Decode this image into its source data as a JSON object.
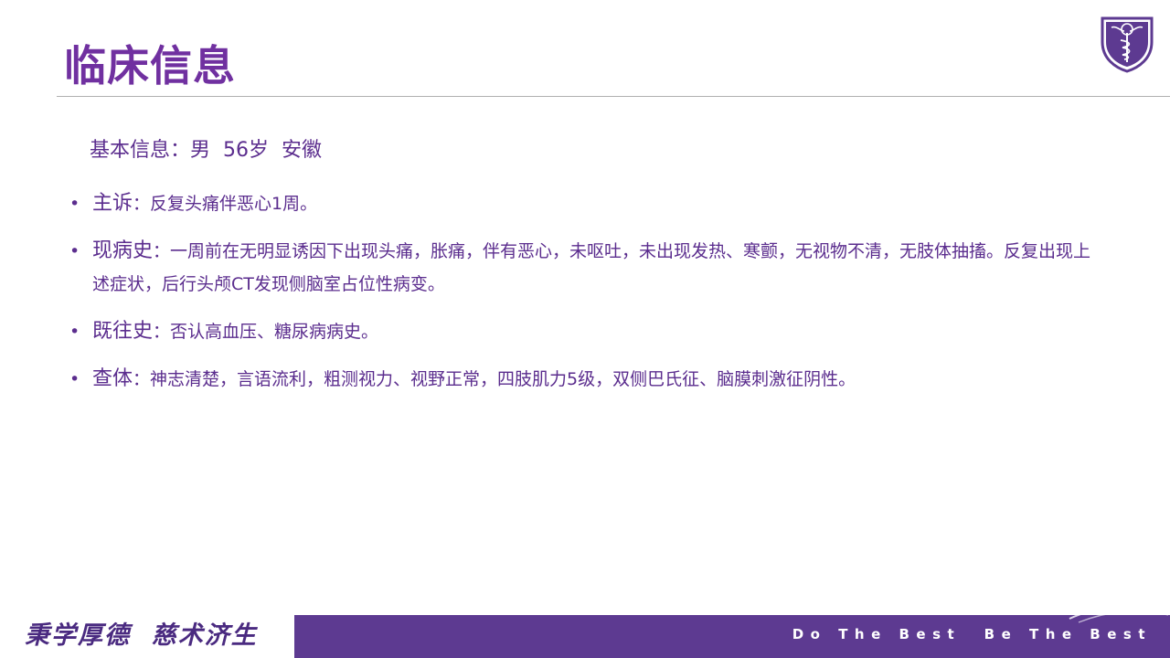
{
  "slide": {
    "title": "临床信息",
    "basic_info": "基本信息：男  56岁  安徽",
    "bullet_symbol": "•",
    "items": [
      {
        "label": "主诉",
        "text": "：反复头痛伴恶心1周。"
      },
      {
        "label": "现病史",
        "text": "：一周前在无明显诱因下出现头痛，胀痛，伴有恶心，未呕吐，未出现发热、寒颤，无视物不清，无肢体抽搐。反复出现上述症状，后行头颅CT发现侧脑室占位性病变。"
      },
      {
        "label": "既往史",
        "text": "：否认高血压、糖尿病病史。"
      },
      {
        "label": "查体",
        "text": "：神志清楚，言语流利，粗测视力、视野正常，四肢肌力5级，双侧巴氏征、脑膜刺激征阴性。"
      }
    ]
  },
  "footer": {
    "motto": "秉学厚德  慈术济生",
    "slogan": "Do The Best  Be The Best"
  },
  "colors": {
    "title": "#7030a0",
    "text": "#5b2d8e",
    "footer_bar": "#5d3a91"
  },
  "icons": {
    "logo": "university-shield-logo-icon"
  }
}
